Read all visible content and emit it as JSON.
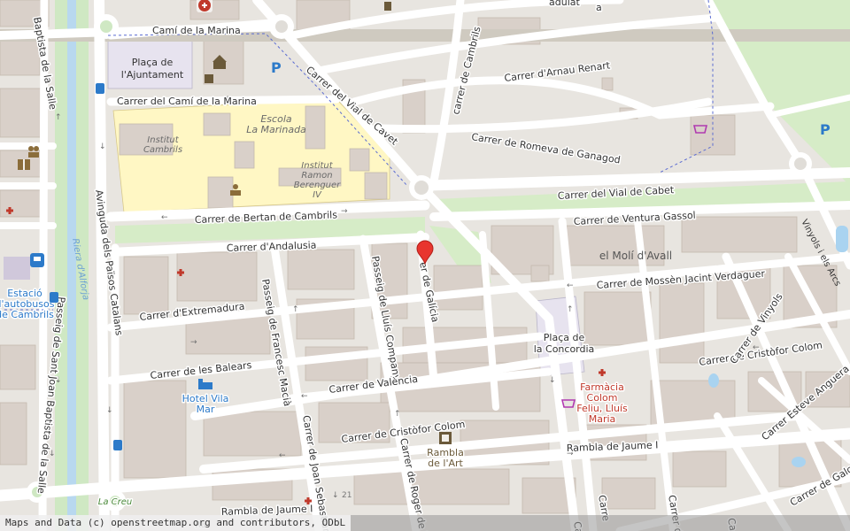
{
  "map": {
    "attribution": "Maps and Data (c) openstreetmap.org and contributors, ODbL",
    "streets": {
      "cami_marina": "Camí de la Marina",
      "cami_marina_carrer": "Carrer del Camí de la Marina",
      "vial_cavet": "Carrer del Vial de Cavet",
      "cambrils": "carrer de Cambrils",
      "arnau": "Carrer d'Arnau Renart",
      "romeva": "Carrer de Romeva de Ganagod",
      "vial_cabet": "Carrer del Vial de Cabet",
      "bertan": "Carrer de Bertan de Cambrils",
      "ventura": "Carrer de Ventura Gassol",
      "andalusia": "Carrer d'Andalusia",
      "galicia": "er de Galícia",
      "mossen": "Carrer de Mossèn Jacint Verdaguer",
      "extremadura": "Carrer d'Extremadura",
      "francesc": "Passeig de Francesc Macià",
      "lluis": "Passeig de Lluís Companys",
      "balears": "Carrer de les Balears",
      "valencia": "Carrer de València",
      "cristofor1": "Carrer de Cristòfor Colom",
      "cristofor2": "Carrer de Cristòfor Colom",
      "jaume1": "Rambla de Jaume I",
      "jaume2": "Rambla de Jaume I",
      "joan_sebastian": "Carrer de Joan Sebastian",
      "roger": "Carrer de Roger de F",
      "vinyols1": "Vinyols i els Arcs",
      "vinyols2": "Carrer de Vinyols",
      "esteve": "Carrer Esteve Anguera",
      "galcera": "Carrer de Galcera",
      "avinguda": "Avinguda dels Països Catalans",
      "baptista1": "Baptista de la Salle",
      "baptista2": "Passeig de Sant Joan Baptista de la Salle",
      "riera": "Riera d'Alforja",
      "rambla_n": "Ra",
      "top_frag1": "adulat",
      "top_frag2": "a",
      "bottom_frag1": "Ca",
      "bottom_frag2": "Carre",
      "bottom_frag3": "Carrer de",
      "bottom_frag4": "Ca"
    },
    "places": {
      "placa_ajuntament_1": "Plaça de",
      "placa_ajuntament_2": "l'Ajuntament",
      "escola_1": "Escola",
      "escola_2": "La Marinada",
      "institut_cambrils_1": "Institut",
      "institut_cambrils_2": "Cambrils",
      "institut_ramon_1": "Institut",
      "institut_ramon_2": "Ramon",
      "institut_ramon_3": "Berenguer",
      "institut_ramon_4": "IV",
      "moli": "el Molí d'Avall",
      "concordia_1": "Plaça de",
      "concordia_2": "la Concordia",
      "farmacia_1": "Farmàcia",
      "farmacia_2": "Colom",
      "farmacia_3": "Feliu, Lluís",
      "farmacia_4": "Maria",
      "hotel_1": "Hotel Vila",
      "hotel_2": "Mar",
      "estacio_1": "Estació",
      "estacio_2": "d'autobusos",
      "estacio_3": "de Cambrils",
      "rambla_art_1": "Rambla",
      "rambla_art_2": "de l'Art",
      "la_creu": "La Creu",
      "house_number": "21",
      "parking": "P",
      "parking2": "P"
    },
    "colors": {
      "background": "#f2efe9",
      "building": "#d9d0c9",
      "school": "#fff7c4",
      "park": "#d6ecc7",
      "water": "#a9d3f0",
      "pharmacy": "#c0392b",
      "transit": "#2c7ac9",
      "marker": "#e8352e"
    },
    "icons": [
      "pharmacy-icon",
      "hospital-icon",
      "library-icon",
      "school-icon",
      "parking-icon",
      "bus-stop-icon",
      "shop-icon",
      "cinema-icon",
      "hotel-icon",
      "map-marker-icon"
    ]
  }
}
